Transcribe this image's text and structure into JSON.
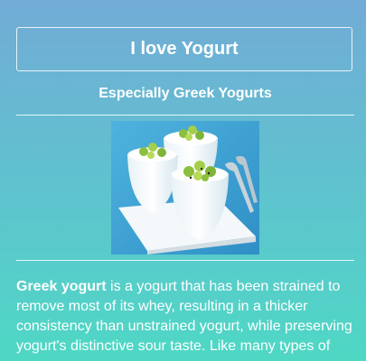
{
  "header": {
    "title": "I love Yogurt",
    "subtitle": "Especially Greek Yogurts"
  },
  "article": {
    "lead_term": "Greek yogurt",
    "body": " is a yogurt that has been strained to remove most of its whey, resulting in a thicker consistency than unstrained yogurt, while preserving yogurt's distinctive sour taste. Like many types of"
  },
  "image": {
    "icon": "greek-yogurt-photo"
  },
  "colors": {
    "gradient_top": "#72abd6",
    "gradient_bottom": "#4ed8c4",
    "text": "#ffffff"
  }
}
